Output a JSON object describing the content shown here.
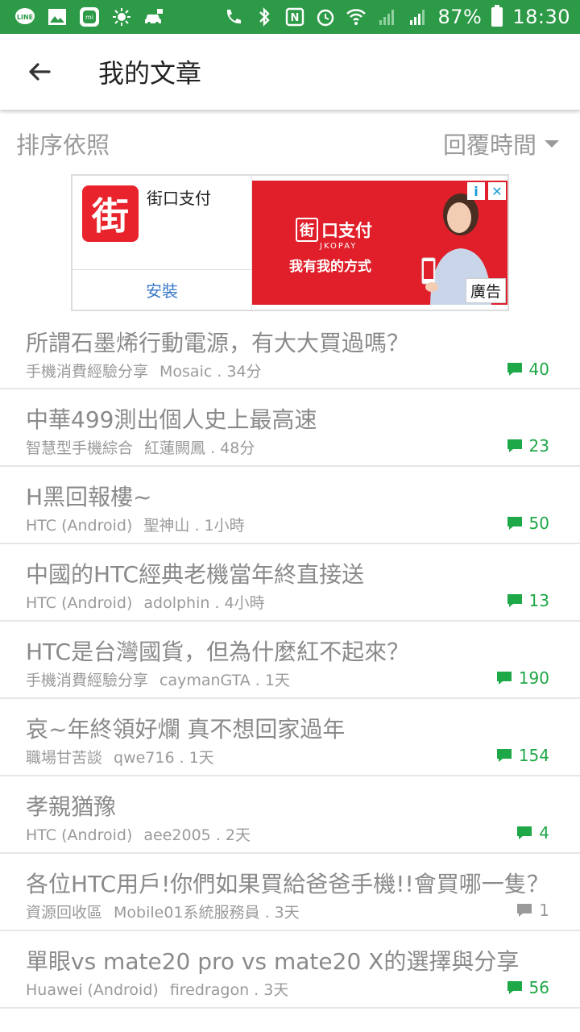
{
  "status_bar": {
    "battery": "87%",
    "time": "18:30",
    "left_icons": [
      "line-icon",
      "gallery-icon",
      "mi-icon",
      "brightness-icon",
      "car-icon"
    ],
    "right_icons": [
      "call-wifi-icon",
      "bluetooth-icon",
      "nfc-icon",
      "alarm-icon",
      "wifi-icon",
      "signal-icon",
      "signal-icon",
      "battery-icon"
    ]
  },
  "appbar": {
    "title": "我的文章",
    "back_icon": "back-arrow-icon"
  },
  "sort": {
    "label": "排序依照",
    "selected": "回覆時間"
  },
  "ad": {
    "app_name": "街口支付",
    "logo_char": "街",
    "install_label": "安裝",
    "banner_brand": "口支付",
    "banner_brand_box": "街",
    "banner_sub": "JKOPAY",
    "banner_slogan": "我有我的方式",
    "badge": "廣告",
    "info_icon": "i",
    "close_icon": "✕"
  },
  "colors": {
    "accent": "#2d9a48",
    "count_green": "#1fa847",
    "ad_red": "#e01f2a",
    "link_blue": "#3a79c9"
  },
  "posts": [
    {
      "title": "所謂石墨烯行動電源，有大大買過嗎？",
      "forum": "手機消費經驗分享",
      "author": "Mosaic",
      "time": ". 34分",
      "count": "40",
      "highlight": true
    },
    {
      "title": "中華499測出個人史上最高速",
      "forum": "智慧型手機綜合",
      "author": "紅蓮闕鳳",
      "time": ". 48分",
      "count": "23",
      "highlight": true
    },
    {
      "title": "H黑回報樓~",
      "forum": "HTC (Android)",
      "author": "聖神山",
      "time": ". 1小時",
      "count": "50",
      "highlight": true
    },
    {
      "title": "中國的HTC經典老機當年終直接送",
      "forum": "HTC (Android)",
      "author": "adolphin",
      "time": ". 4小時",
      "count": "13",
      "highlight": true
    },
    {
      "title": "HTC是台灣國貨，但為什麼紅不起來？",
      "forum": "手機消費經驗分享",
      "author": "caymanGTA",
      "time": ". 1天",
      "count": "190",
      "highlight": true
    },
    {
      "title": "哀~年終領好爛 真不想回家過年",
      "forum": "職場甘苦談",
      "author": "qwe716",
      "time": ". 1天",
      "count": "154",
      "highlight": true
    },
    {
      "title": "孝親猶豫",
      "forum": "HTC (Android)",
      "author": "aee2005",
      "time": ". 2天",
      "count": "4",
      "highlight": true
    },
    {
      "title": "各位HTC用戶!你們如果買給爸爸手機!!會買哪一隻？",
      "forum": "資源回收區",
      "author": "Mobile01系統服務員",
      "time": ". 3天",
      "count": "1",
      "highlight": false
    },
    {
      "title": "單眼vs mate20 pro vs mate20 X的選擇與分享",
      "forum": "Huawei (Android)",
      "author": "firedragon",
      "time": ". 3天",
      "count": "56",
      "highlight": true
    }
  ]
}
